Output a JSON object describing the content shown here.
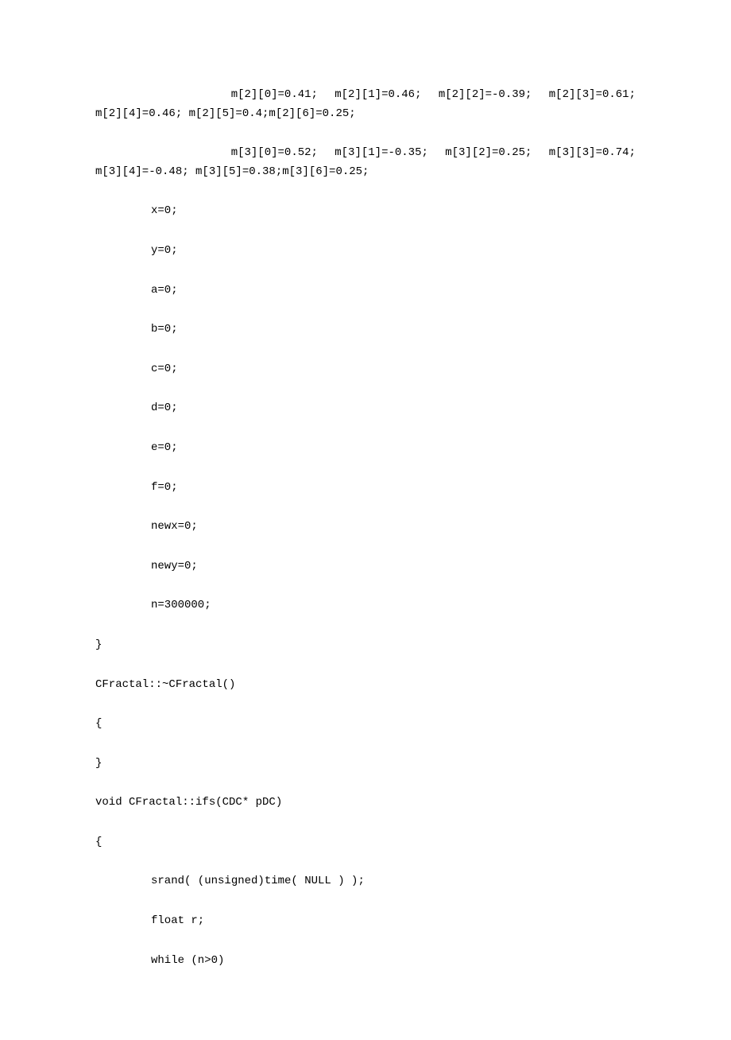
{
  "code": {
    "l1a": "        m[2][0]=0.41; m[2][1]=0.46; m[2][2]=-0.39; m[2][3]=0.61;",
    "l1b": "m[2][4]=0.46; m[2][5]=0.4;m[2][6]=0.25;",
    "l2a": "        m[3][0]=0.52; m[3][1]=-0.35; m[3][2]=0.25; m[3][3]=0.74;",
    "l2b": "m[3][4]=-0.48; m[3][5]=0.38;m[3][6]=0.25;",
    "l3": "x=0;",
    "l4": "y=0;",
    "l5": "a=0;",
    "l6": "b=0;",
    "l7": "c=0;",
    "l8": "d=0;",
    "l9": "e=0;",
    "l10": "f=0;",
    "l11": "newx=0;",
    "l12": "newy=0;",
    "l13": "n=300000;",
    "l14": "}",
    "l15": "CFractal::~CFractal()",
    "l16": "{",
    "l17": "}",
    "l18": "void CFractal::ifs(CDC* pDC)",
    "l19": "{",
    "l20": "srand( (unsigned)time( NULL ) );",
    "l21": "float r;",
    "l22": "while (n>0)"
  }
}
